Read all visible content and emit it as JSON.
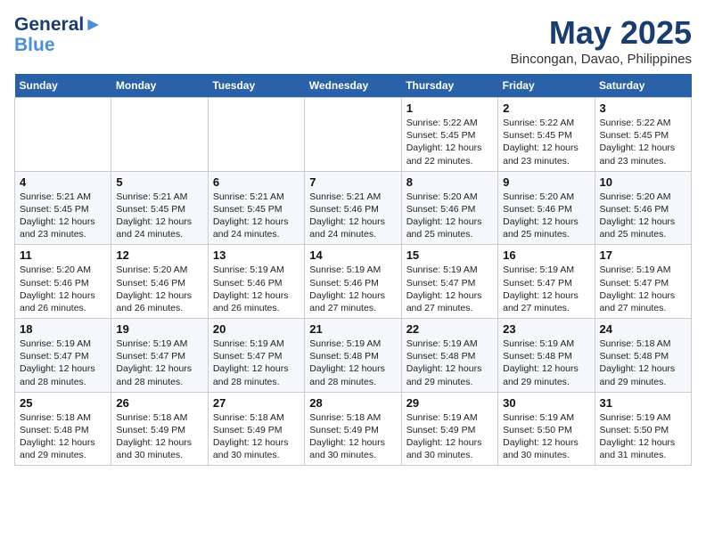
{
  "header": {
    "logo_line1": "General",
    "logo_line2": "Blue",
    "month": "May 2025",
    "location": "Bincongan, Davao, Philippines"
  },
  "weekdays": [
    "Sunday",
    "Monday",
    "Tuesday",
    "Wednesday",
    "Thursday",
    "Friday",
    "Saturday"
  ],
  "weeks": [
    [
      {
        "day": "",
        "info": ""
      },
      {
        "day": "",
        "info": ""
      },
      {
        "day": "",
        "info": ""
      },
      {
        "day": "",
        "info": ""
      },
      {
        "day": "1",
        "info": "Sunrise: 5:22 AM\nSunset: 5:45 PM\nDaylight: 12 hours\nand 22 minutes."
      },
      {
        "day": "2",
        "info": "Sunrise: 5:22 AM\nSunset: 5:45 PM\nDaylight: 12 hours\nand 23 minutes."
      },
      {
        "day": "3",
        "info": "Sunrise: 5:22 AM\nSunset: 5:45 PM\nDaylight: 12 hours\nand 23 minutes."
      }
    ],
    [
      {
        "day": "4",
        "info": "Sunrise: 5:21 AM\nSunset: 5:45 PM\nDaylight: 12 hours\nand 23 minutes."
      },
      {
        "day": "5",
        "info": "Sunrise: 5:21 AM\nSunset: 5:45 PM\nDaylight: 12 hours\nand 24 minutes."
      },
      {
        "day": "6",
        "info": "Sunrise: 5:21 AM\nSunset: 5:45 PM\nDaylight: 12 hours\nand 24 minutes."
      },
      {
        "day": "7",
        "info": "Sunrise: 5:21 AM\nSunset: 5:46 PM\nDaylight: 12 hours\nand 24 minutes."
      },
      {
        "day": "8",
        "info": "Sunrise: 5:20 AM\nSunset: 5:46 PM\nDaylight: 12 hours\nand 25 minutes."
      },
      {
        "day": "9",
        "info": "Sunrise: 5:20 AM\nSunset: 5:46 PM\nDaylight: 12 hours\nand 25 minutes."
      },
      {
        "day": "10",
        "info": "Sunrise: 5:20 AM\nSunset: 5:46 PM\nDaylight: 12 hours\nand 25 minutes."
      }
    ],
    [
      {
        "day": "11",
        "info": "Sunrise: 5:20 AM\nSunset: 5:46 PM\nDaylight: 12 hours\nand 26 minutes."
      },
      {
        "day": "12",
        "info": "Sunrise: 5:20 AM\nSunset: 5:46 PM\nDaylight: 12 hours\nand 26 minutes."
      },
      {
        "day": "13",
        "info": "Sunrise: 5:19 AM\nSunset: 5:46 PM\nDaylight: 12 hours\nand 26 minutes."
      },
      {
        "day": "14",
        "info": "Sunrise: 5:19 AM\nSunset: 5:46 PM\nDaylight: 12 hours\nand 27 minutes."
      },
      {
        "day": "15",
        "info": "Sunrise: 5:19 AM\nSunset: 5:47 PM\nDaylight: 12 hours\nand 27 minutes."
      },
      {
        "day": "16",
        "info": "Sunrise: 5:19 AM\nSunset: 5:47 PM\nDaylight: 12 hours\nand 27 minutes."
      },
      {
        "day": "17",
        "info": "Sunrise: 5:19 AM\nSunset: 5:47 PM\nDaylight: 12 hours\nand 27 minutes."
      }
    ],
    [
      {
        "day": "18",
        "info": "Sunrise: 5:19 AM\nSunset: 5:47 PM\nDaylight: 12 hours\nand 28 minutes."
      },
      {
        "day": "19",
        "info": "Sunrise: 5:19 AM\nSunset: 5:47 PM\nDaylight: 12 hours\nand 28 minutes."
      },
      {
        "day": "20",
        "info": "Sunrise: 5:19 AM\nSunset: 5:47 PM\nDaylight: 12 hours\nand 28 minutes."
      },
      {
        "day": "21",
        "info": "Sunrise: 5:19 AM\nSunset: 5:48 PM\nDaylight: 12 hours\nand 28 minutes."
      },
      {
        "day": "22",
        "info": "Sunrise: 5:19 AM\nSunset: 5:48 PM\nDaylight: 12 hours\nand 29 minutes."
      },
      {
        "day": "23",
        "info": "Sunrise: 5:19 AM\nSunset: 5:48 PM\nDaylight: 12 hours\nand 29 minutes."
      },
      {
        "day": "24",
        "info": "Sunrise: 5:18 AM\nSunset: 5:48 PM\nDaylight: 12 hours\nand 29 minutes."
      }
    ],
    [
      {
        "day": "25",
        "info": "Sunrise: 5:18 AM\nSunset: 5:48 PM\nDaylight: 12 hours\nand 29 minutes."
      },
      {
        "day": "26",
        "info": "Sunrise: 5:18 AM\nSunset: 5:49 PM\nDaylight: 12 hours\nand 30 minutes."
      },
      {
        "day": "27",
        "info": "Sunrise: 5:18 AM\nSunset: 5:49 PM\nDaylight: 12 hours\nand 30 minutes."
      },
      {
        "day": "28",
        "info": "Sunrise: 5:18 AM\nSunset: 5:49 PM\nDaylight: 12 hours\nand 30 minutes."
      },
      {
        "day": "29",
        "info": "Sunrise: 5:19 AM\nSunset: 5:49 PM\nDaylight: 12 hours\nand 30 minutes."
      },
      {
        "day": "30",
        "info": "Sunrise: 5:19 AM\nSunset: 5:50 PM\nDaylight: 12 hours\nand 30 minutes."
      },
      {
        "day": "31",
        "info": "Sunrise: 5:19 AM\nSunset: 5:50 PM\nDaylight: 12 hours\nand 31 minutes."
      }
    ]
  ]
}
